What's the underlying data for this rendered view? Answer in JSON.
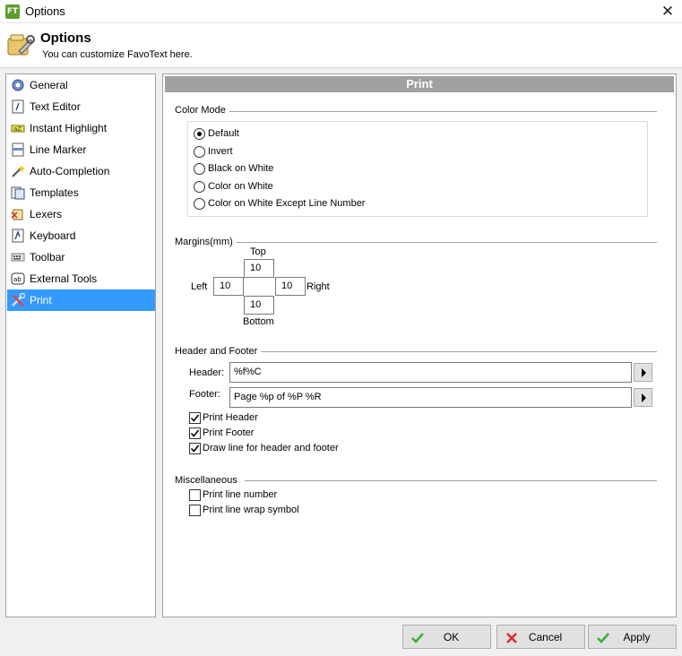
{
  "window": {
    "app_icon": "FT",
    "title": "Options",
    "close_glyph": "✕"
  },
  "header": {
    "title": "Options",
    "subtitle": "You can customize FavoText here."
  },
  "sidebar": {
    "items": [
      {
        "label": "General",
        "icon": "gear-icon"
      },
      {
        "label": "Text Editor",
        "icon": "text-editor-icon"
      },
      {
        "label": "Instant Highlight",
        "icon": "highlight-icon"
      },
      {
        "label": "Line Marker",
        "icon": "line-marker-icon"
      },
      {
        "label": "Auto-Completion",
        "icon": "wand-icon"
      },
      {
        "label": "Templates",
        "icon": "templates-icon"
      },
      {
        "label": "Lexers",
        "icon": "lexers-icon"
      },
      {
        "label": "Keyboard",
        "icon": "keyboard-icon"
      },
      {
        "label": "Toolbar",
        "icon": "toolbar-icon"
      },
      {
        "label": "External Tools",
        "icon": "external-tools-icon"
      },
      {
        "label": "Print",
        "icon": "tools-icon",
        "selected": true
      }
    ]
  },
  "print": {
    "section_title": "Print",
    "color_mode": {
      "label": "Color Mode",
      "options": [
        "Default",
        "Invert",
        "Black on White",
        "Color on White",
        "Color on White Except Line Number"
      ],
      "selected": "Default"
    },
    "margins": {
      "label": "Margins(mm)",
      "top_label": "Top",
      "top": "10",
      "left_label": "Left",
      "left": "10",
      "right_label": "Right",
      "right": "10",
      "bottom_label": "Bottom",
      "bottom": "10"
    },
    "header_footer": {
      "label": "Header and Footer",
      "header_label": "Header:",
      "header_value": "%f%C",
      "footer_label": "Footer:",
      "footer_value": "Page %p of %P %R",
      "checks": [
        {
          "label": "Print Header",
          "checked": true
        },
        {
          "label": "Print Footer",
          "checked": true
        },
        {
          "label": "Draw line for header and footer",
          "checked": true
        }
      ]
    },
    "misc": {
      "label": "Miscellaneous",
      "checks": [
        {
          "label": "Print line number",
          "checked": false
        },
        {
          "label": "Print line wrap symbol",
          "checked": false
        }
      ]
    }
  },
  "buttons": {
    "ok": "OK",
    "cancel": "Cancel",
    "apply": "Apply"
  },
  "colors": {
    "selection": "#3399ff",
    "section_bar": "#a0a0a0",
    "ok_check": "#3cae3c",
    "cancel_x": "#d9302c"
  }
}
